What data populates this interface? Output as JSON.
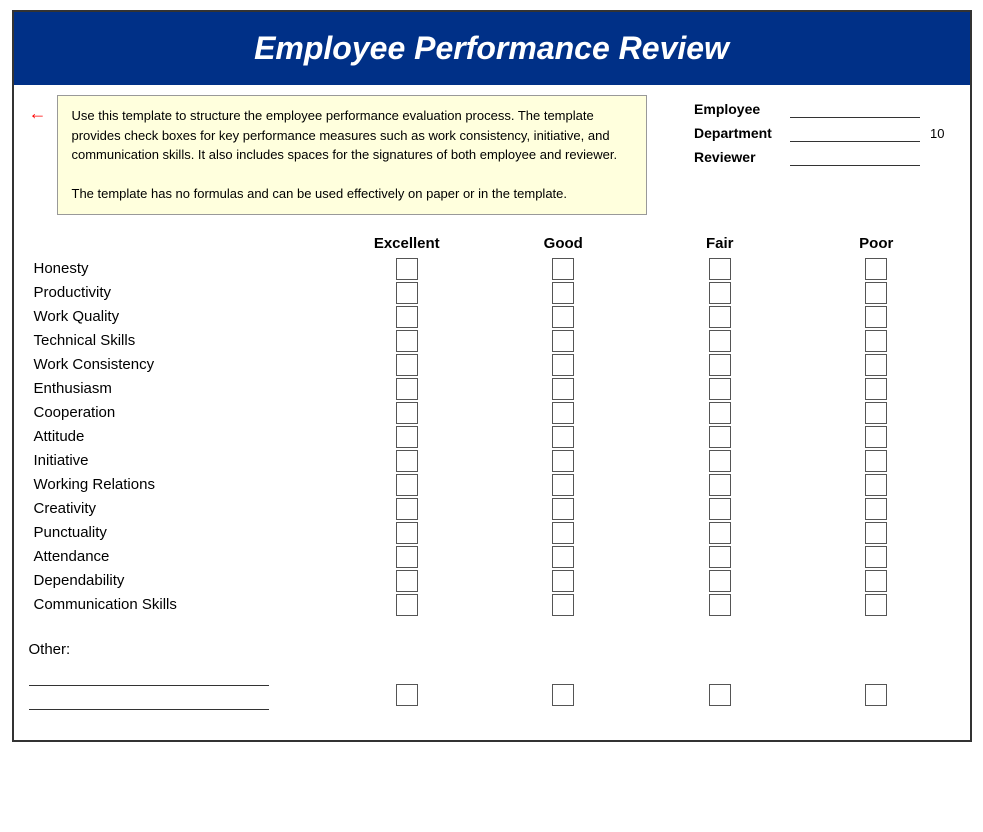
{
  "header": {
    "title": "Employee Performance Review"
  },
  "tooltip": {
    "text": "Use this template to structure the employee performance evaluation process. The template provides check boxes for key performance measures such as work consistency, initiative, and communication skills. It also includes spaces for the signatures of both employee and reviewer.\n\nThe template has no formulas and can be used effectively on paper or in the template."
  },
  "fields": [
    {
      "label": "Employee",
      "value": "",
      "number": ""
    },
    {
      "label": "Department",
      "value": "",
      "number": "10"
    },
    {
      "label": "Reviewer",
      "value": "",
      "number": ""
    }
  ],
  "ratings": {
    "columns": [
      "",
      "Excellent",
      "Good",
      "Fair",
      "Poor"
    ],
    "rows": [
      "Honesty",
      "Productivity",
      "Work Quality",
      "Technical Skills",
      "Work Consistency",
      "Enthusiasm",
      "Cooperation",
      "Attitude",
      "Initiative",
      "Working Relations",
      "Creativity",
      "Punctuality",
      "Attendance",
      "Dependability",
      "Communication Skills"
    ]
  },
  "other": {
    "label": "Other:"
  }
}
